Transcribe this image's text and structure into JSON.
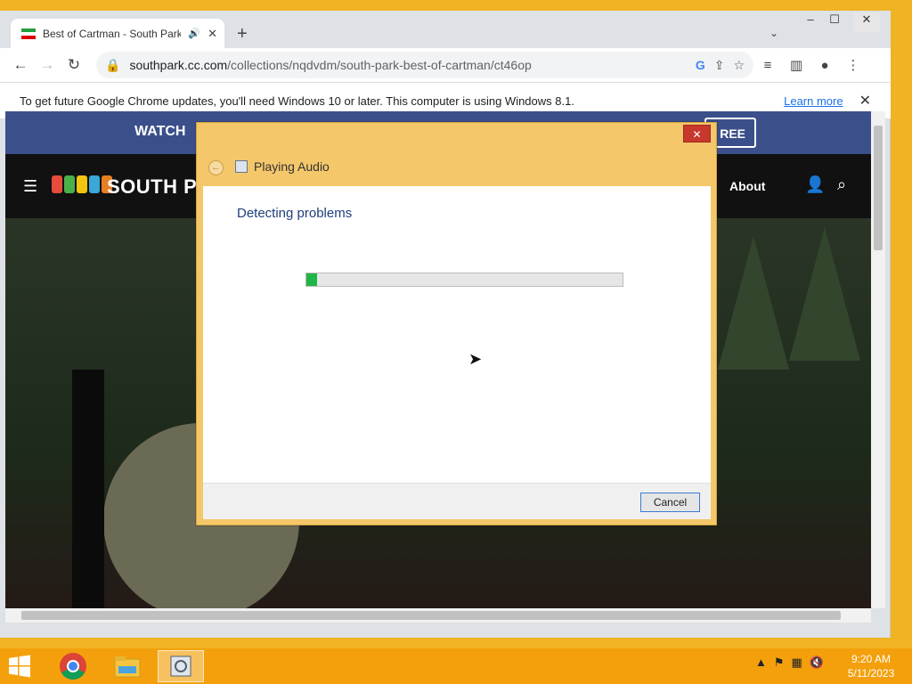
{
  "browser": {
    "tab_title": "Best of Cartman - South Park",
    "new_tab_symbol": "+",
    "url_domain": "southpark.cc.com",
    "url_path": "/collections/nqdvdm/south-park-best-of-cartman/ct46op",
    "infobar_message": "To get future Google Chrome updates, you'll need Windows 10 or later. This computer is using Windows 8.1.",
    "infobar_link": "Learn more"
  },
  "site": {
    "banner_text": "WATCH",
    "banner_button": "REE",
    "brand": "SOUTH P",
    "nav_about": "About"
  },
  "dialog": {
    "title": "Playing Audio",
    "heading": "Detecting problems",
    "progress": 0.035,
    "cancel_label": "Cancel",
    "close_symbol": "✕"
  },
  "taskbar": {
    "time": "9:20 AM",
    "date": "5/11/2023",
    "apps": [
      "chrome-icon",
      "file-explorer-icon",
      "troubleshooter-icon"
    ]
  },
  "colors": {
    "dialog_frame": "#f4c76a",
    "progress_fill": "#1fb548",
    "taskbar": "#f3a00c",
    "desktop": "#f0b323"
  }
}
